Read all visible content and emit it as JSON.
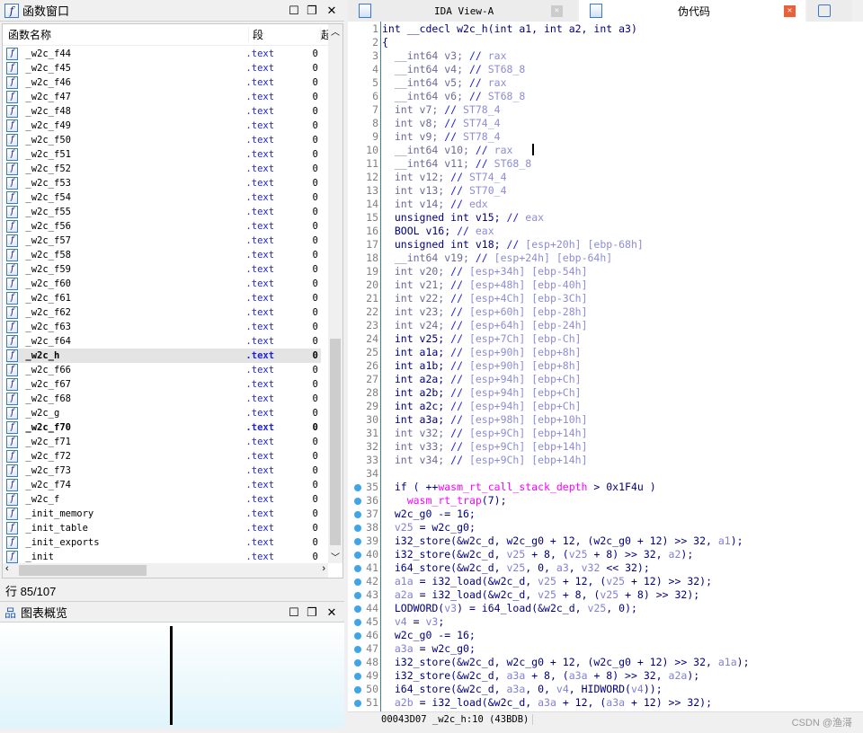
{
  "functions_window": {
    "title": "函数窗口",
    "col_name": "函数名称",
    "col_segment": "段",
    "col_start": "起",
    "rows": [
      {
        "name": "_w2c_f44",
        "seg": ".text",
        "addr": "0"
      },
      {
        "name": "_w2c_f45",
        "seg": ".text",
        "addr": "0"
      },
      {
        "name": "_w2c_f46",
        "seg": ".text",
        "addr": "0"
      },
      {
        "name": "_w2c_f47",
        "seg": ".text",
        "addr": "0"
      },
      {
        "name": "_w2c_f48",
        "seg": ".text",
        "addr": "0"
      },
      {
        "name": "_w2c_f49",
        "seg": ".text",
        "addr": "0"
      },
      {
        "name": "_w2c_f50",
        "seg": ".text",
        "addr": "0"
      },
      {
        "name": "_w2c_f51",
        "seg": ".text",
        "addr": "0"
      },
      {
        "name": "_w2c_f52",
        "seg": ".text",
        "addr": "0"
      },
      {
        "name": "_w2c_f53",
        "seg": ".text",
        "addr": "0"
      },
      {
        "name": "_w2c_f54",
        "seg": ".text",
        "addr": "0"
      },
      {
        "name": "_w2c_f55",
        "seg": ".text",
        "addr": "0"
      },
      {
        "name": "_w2c_f56",
        "seg": ".text",
        "addr": "0"
      },
      {
        "name": "_w2c_f57",
        "seg": ".text",
        "addr": "0"
      },
      {
        "name": "_w2c_f58",
        "seg": ".text",
        "addr": "0"
      },
      {
        "name": "_w2c_f59",
        "seg": ".text",
        "addr": "0"
      },
      {
        "name": "_w2c_f60",
        "seg": ".text",
        "addr": "0"
      },
      {
        "name": "_w2c_f61",
        "seg": ".text",
        "addr": "0"
      },
      {
        "name": "_w2c_f62",
        "seg": ".text",
        "addr": "0"
      },
      {
        "name": "_w2c_f63",
        "seg": ".text",
        "addr": "0"
      },
      {
        "name": "_w2c_f64",
        "seg": ".text",
        "addr": "0"
      },
      {
        "name": "_w2c_h",
        "seg": ".text",
        "addr": "0",
        "style": "sel"
      },
      {
        "name": "_w2c_f66",
        "seg": ".text",
        "addr": "0"
      },
      {
        "name": "_w2c_f67",
        "seg": ".text",
        "addr": "0"
      },
      {
        "name": "_w2c_f68",
        "seg": ".text",
        "addr": "0"
      },
      {
        "name": "_w2c_g",
        "seg": ".text",
        "addr": "0"
      },
      {
        "name": "_w2c_f70",
        "seg": ".text",
        "addr": "0",
        "style": "bold"
      },
      {
        "name": "_w2c_f71",
        "seg": ".text",
        "addr": "0"
      },
      {
        "name": "_w2c_f72",
        "seg": ".text",
        "addr": "0"
      },
      {
        "name": "_w2c_f73",
        "seg": ".text",
        "addr": "0"
      },
      {
        "name": "_w2c_f74",
        "seg": ".text",
        "addr": "0"
      },
      {
        "name": "_w2c_f",
        "seg": ".text",
        "addr": "0"
      },
      {
        "name": "_init_memory",
        "seg": ".text",
        "addr": "0"
      },
      {
        "name": "_init_table",
        "seg": ".text",
        "addr": "0"
      },
      {
        "name": "_init_exports",
        "seg": ".text",
        "addr": "0"
      },
      {
        "name": "_init",
        "seg": ".text",
        "addr": "0"
      }
    ],
    "status": "行 85/107"
  },
  "graph_overview": {
    "title": "图表概览"
  },
  "tabs": [
    {
      "label": "IDA View-A",
      "active": false
    },
    {
      "label": "伪代码",
      "active": true
    }
  ],
  "pseudocode": {
    "status": "00043D07 _w2c_h:10 (43BDB)",
    "lines": [
      [
        [
          "t",
          "int __cdecl w2c_h(int a1, int a2, int a3)"
        ]
      ],
      [
        [
          "t",
          "{"
        ]
      ],
      [
        [
          "d",
          "  __int64 v3; "
        ],
        [
          "s",
          "// "
        ],
        [
          "c",
          "rax"
        ]
      ],
      [
        [
          "d",
          "  __int64 v4; "
        ],
        [
          "s",
          "// "
        ],
        [
          "c",
          "ST68_8"
        ]
      ],
      [
        [
          "d",
          "  __int64 v5; "
        ],
        [
          "s",
          "// "
        ],
        [
          "c",
          "rax"
        ]
      ],
      [
        [
          "d",
          "  __int64 v6; "
        ],
        [
          "s",
          "// "
        ],
        [
          "c",
          "ST68_8"
        ]
      ],
      [
        [
          "d",
          "  int v7; "
        ],
        [
          "s",
          "// "
        ],
        [
          "c",
          "ST78_4"
        ]
      ],
      [
        [
          "d",
          "  int v8; "
        ],
        [
          "s",
          "// "
        ],
        [
          "c",
          "ST74_4"
        ]
      ],
      [
        [
          "d",
          "  int v9; "
        ],
        [
          "s",
          "// "
        ],
        [
          "c",
          "ST78_4"
        ]
      ],
      [
        [
          "d",
          "  __int64 v10; "
        ],
        [
          "s",
          "// "
        ],
        [
          "c",
          "rax"
        ]
      ],
      [
        [
          "d",
          "  __int64 v11; "
        ],
        [
          "s",
          "// "
        ],
        [
          "c",
          "ST68_8"
        ]
      ],
      [
        [
          "d",
          "  int v12; "
        ],
        [
          "s",
          "// "
        ],
        [
          "c",
          "ST74_4"
        ]
      ],
      [
        [
          "d",
          "  int v13; "
        ],
        [
          "s",
          "// "
        ],
        [
          "c",
          "ST70_4"
        ]
      ],
      [
        [
          "d",
          "  int v14; "
        ],
        [
          "s",
          "// "
        ],
        [
          "c",
          "edx"
        ]
      ],
      [
        [
          "t",
          "  unsigned int v15; "
        ],
        [
          "s",
          "// "
        ],
        [
          "c",
          "eax"
        ]
      ],
      [
        [
          "t",
          "  BOOL v16; "
        ],
        [
          "s",
          "// "
        ],
        [
          "c",
          "eax"
        ]
      ],
      [
        [
          "t",
          "  unsigned int v18; "
        ],
        [
          "s",
          "// "
        ],
        [
          "c",
          "[esp+20h] [ebp-68h]"
        ]
      ],
      [
        [
          "d",
          "  __int64 v19; "
        ],
        [
          "s",
          "// "
        ],
        [
          "c",
          "[esp+24h] [ebp-64h]"
        ]
      ],
      [
        [
          "d",
          "  int v20; "
        ],
        [
          "s",
          "// "
        ],
        [
          "c",
          "[esp+34h] [ebp-54h]"
        ]
      ],
      [
        [
          "d",
          "  int v21; "
        ],
        [
          "s",
          "// "
        ],
        [
          "c",
          "[esp+48h] [ebp-40h]"
        ]
      ],
      [
        [
          "d",
          "  int v22; "
        ],
        [
          "s",
          "// "
        ],
        [
          "c",
          "[esp+4Ch] [ebp-3Ch]"
        ]
      ],
      [
        [
          "d",
          "  int v23; "
        ],
        [
          "s",
          "// "
        ],
        [
          "c",
          "[esp+60h] [ebp-28h]"
        ]
      ],
      [
        [
          "d",
          "  int v24; "
        ],
        [
          "s",
          "// "
        ],
        [
          "c",
          "[esp+64h] [ebp-24h]"
        ]
      ],
      [
        [
          "t",
          "  int v25; "
        ],
        [
          "s",
          "// "
        ],
        [
          "c",
          "[esp+7Ch] [ebp-Ch]"
        ]
      ],
      [
        [
          "t",
          "  int a1a; "
        ],
        [
          "s",
          "// "
        ],
        [
          "c",
          "[esp+90h] [ebp+8h]"
        ]
      ],
      [
        [
          "t",
          "  int a1b; "
        ],
        [
          "s",
          "// "
        ],
        [
          "c",
          "[esp+90h] [ebp+8h]"
        ]
      ],
      [
        [
          "t",
          "  int a2a; "
        ],
        [
          "s",
          "// "
        ],
        [
          "c",
          "[esp+94h] [ebp+Ch]"
        ]
      ],
      [
        [
          "t",
          "  int a2b; "
        ],
        [
          "s",
          "// "
        ],
        [
          "c",
          "[esp+94h] [ebp+Ch]"
        ]
      ],
      [
        [
          "t",
          "  int a2c; "
        ],
        [
          "s",
          "// "
        ],
        [
          "c",
          "[esp+94h] [ebp+Ch]"
        ]
      ],
      [
        [
          "t",
          "  int a3a; "
        ],
        [
          "s",
          "// "
        ],
        [
          "c",
          "[esp+98h] [ebp+10h]"
        ]
      ],
      [
        [
          "d",
          "  int v32; "
        ],
        [
          "s",
          "// "
        ],
        [
          "c",
          "[esp+9Ch] [ebp+14h]"
        ]
      ],
      [
        [
          "d",
          "  int v33; "
        ],
        [
          "s",
          "// "
        ],
        [
          "c",
          "[esp+9Ch] [ebp+14h]"
        ]
      ],
      [
        [
          "d",
          "  int v34; "
        ],
        [
          "s",
          "// "
        ],
        [
          "c",
          "[esp+9Ch] [ebp+14h]"
        ]
      ],
      [],
      [
        [
          "t",
          "  if ( ++"
        ],
        [
          "f",
          "wasm_rt_call_stack_depth"
        ],
        [
          "t",
          " > 0x1F4u )"
        ]
      ],
      [
        [
          "t",
          "    "
        ],
        [
          "f",
          "wasm_rt_trap"
        ],
        [
          "t",
          "(7);"
        ]
      ],
      [
        [
          "t",
          "  w2c_g0 -= 16;"
        ]
      ],
      [
        [
          "t",
          "  "
        ],
        [
          "v",
          "v25"
        ],
        [
          "t",
          " = w2c_g0;"
        ]
      ],
      [
        [
          "t",
          "  i32_store(&w2c_d, w2c_g0 + 12, (w2c_g0 + 12) >> 32, "
        ],
        [
          "v",
          "a1"
        ],
        [
          "t",
          ");"
        ]
      ],
      [
        [
          "t",
          "  i32_store(&w2c_d, "
        ],
        [
          "v",
          "v25"
        ],
        [
          "t",
          " + 8, ("
        ],
        [
          "v",
          "v25"
        ],
        [
          "t",
          " + 8) >> 32, "
        ],
        [
          "v",
          "a2"
        ],
        [
          "t",
          ");"
        ]
      ],
      [
        [
          "t",
          "  i64_store(&w2c_d, "
        ],
        [
          "v",
          "v25"
        ],
        [
          "t",
          ", 0, "
        ],
        [
          "v",
          "a3"
        ],
        [
          "t",
          ", "
        ],
        [
          "v",
          "v32"
        ],
        [
          "t",
          " << 32);"
        ]
      ],
      [
        [
          "t",
          "  "
        ],
        [
          "v",
          "a1a"
        ],
        [
          "t",
          " = i32_load(&w2c_d, "
        ],
        [
          "v",
          "v25"
        ],
        [
          "t",
          " + 12, ("
        ],
        [
          "v",
          "v25"
        ],
        [
          "t",
          " + 12) >> 32);"
        ]
      ],
      [
        [
          "t",
          "  "
        ],
        [
          "v",
          "a2a"
        ],
        [
          "t",
          " = i32_load(&w2c_d, "
        ],
        [
          "v",
          "v25"
        ],
        [
          "t",
          " + 8, ("
        ],
        [
          "v",
          "v25"
        ],
        [
          "t",
          " + 8) >> 32);"
        ]
      ],
      [
        [
          "t",
          "  LODWORD("
        ],
        [
          "v",
          "v3"
        ],
        [
          "t",
          ") = i64_load(&w2c_d, "
        ],
        [
          "v",
          "v25"
        ],
        [
          "t",
          ", 0);"
        ]
      ],
      [
        [
          "t",
          "  "
        ],
        [
          "v",
          "v4"
        ],
        [
          "t",
          " = "
        ],
        [
          "v",
          "v3"
        ],
        [
          "t",
          ";"
        ]
      ],
      [
        [
          "t",
          "  w2c_g0 -= 16;"
        ]
      ],
      [
        [
          "t",
          "  "
        ],
        [
          "v",
          "a3a"
        ],
        [
          "t",
          " = w2c_g0;"
        ]
      ],
      [
        [
          "t",
          "  i32_store(&w2c_d, w2c_g0 + 12, (w2c_g0 + 12) >> 32, "
        ],
        [
          "v",
          "a1a"
        ],
        [
          "t",
          ");"
        ]
      ],
      [
        [
          "t",
          "  i32_store(&w2c_d, "
        ],
        [
          "v",
          "a3a"
        ],
        [
          "t",
          " + 8, ("
        ],
        [
          "v",
          "a3a"
        ],
        [
          "t",
          " + 8) >> 32, "
        ],
        [
          "v",
          "a2a"
        ],
        [
          "t",
          ");"
        ]
      ],
      [
        [
          "t",
          "  i64_store(&w2c_d, "
        ],
        [
          "v",
          "a3a"
        ],
        [
          "t",
          ", 0, "
        ],
        [
          "v",
          "v4"
        ],
        [
          "t",
          ", HIDWORD("
        ],
        [
          "v",
          "v4"
        ],
        [
          "t",
          "));"
        ]
      ],
      [
        [
          "t",
          "  "
        ],
        [
          "v",
          "a2b"
        ],
        [
          "t",
          " = i32_load(&w2c_d, "
        ],
        [
          "v",
          "a3a"
        ],
        [
          "t",
          " + 12, ("
        ],
        [
          "v",
          "a3a"
        ],
        [
          "t",
          " + 12) >> 32);"
        ]
      ]
    ],
    "breakpoint_lines_from": 35
  },
  "watermark": "CSDN @渔滒",
  "colors": {
    "accent": "#3a78c8",
    "breakpoint": "#3fa5e8",
    "import_fn": "#ff00ff",
    "close_active": "#e8603c"
  }
}
